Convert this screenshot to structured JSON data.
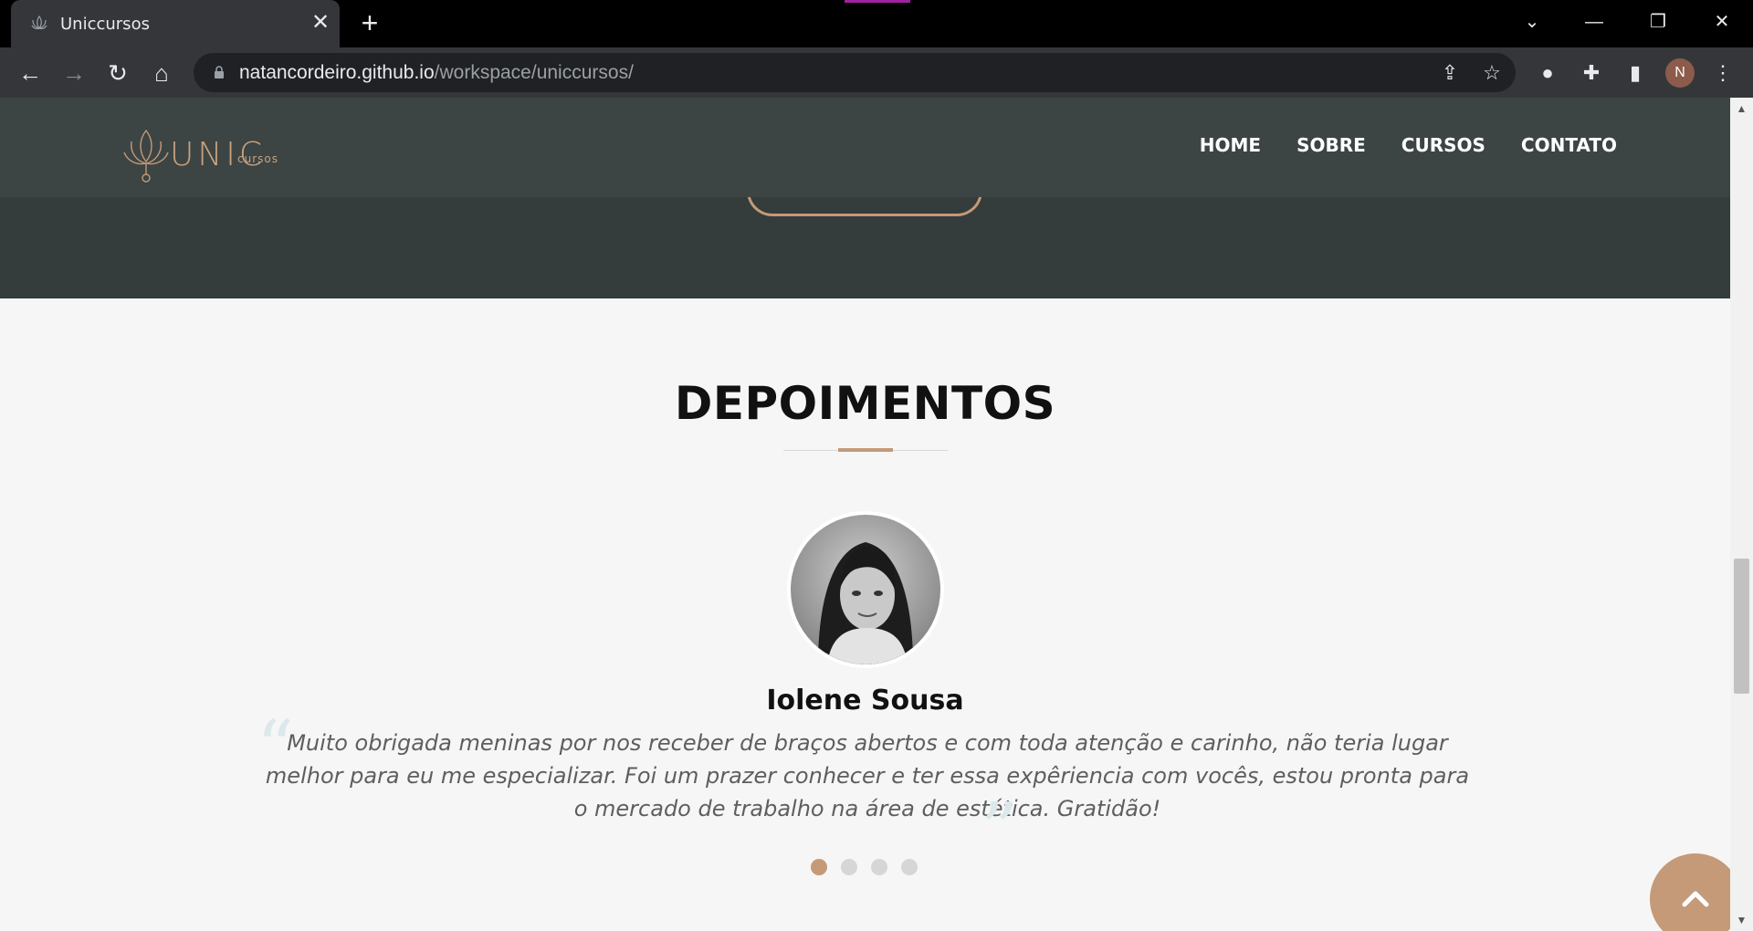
{
  "browser": {
    "tab_title": "Uniccursos",
    "tab_close": "✕",
    "new_tab": "+",
    "url_host": "natancordeiro.github.io",
    "url_path": "/workspace/uniccursos/",
    "avatar_letter": "N"
  },
  "site": {
    "logo_text": "UNIC",
    "logo_sub": "cursos",
    "nav": [
      "HOME",
      "SOBRE",
      "CURSOS",
      "CONTATO"
    ]
  },
  "testimonials": {
    "title": "DEPOIMENTOS",
    "name": "Iolene Sousa",
    "quote": "Muito obrigada meninas por nos receber de braços abertos e com toda atenção e carinho, não teria lugar melhor para eu me especializar. Foi um prazer conhecer e ter essa expêriencia com vocês, estou pronta para o mercado de trabalho na área de estética. Gratidão!",
    "open_quote": "“",
    "close_quote": "”",
    "dots": 4,
    "active_dot": 0
  },
  "colors": {
    "accent": "#c49a78",
    "header_bg": "#3d4544",
    "hero_bg": "#353c3c",
    "page_bg": "#f6f6f6"
  },
  "icons": [
    "lotus-favicon-icon",
    "back-arrow-icon",
    "forward-arrow-icon",
    "reload-icon",
    "home-icon",
    "lock-icon",
    "share-icon",
    "star-icon",
    "extension-icon",
    "puzzle-icon",
    "side-panel-icon",
    "menu-kebab-icon",
    "chevron-up-icon"
  ]
}
